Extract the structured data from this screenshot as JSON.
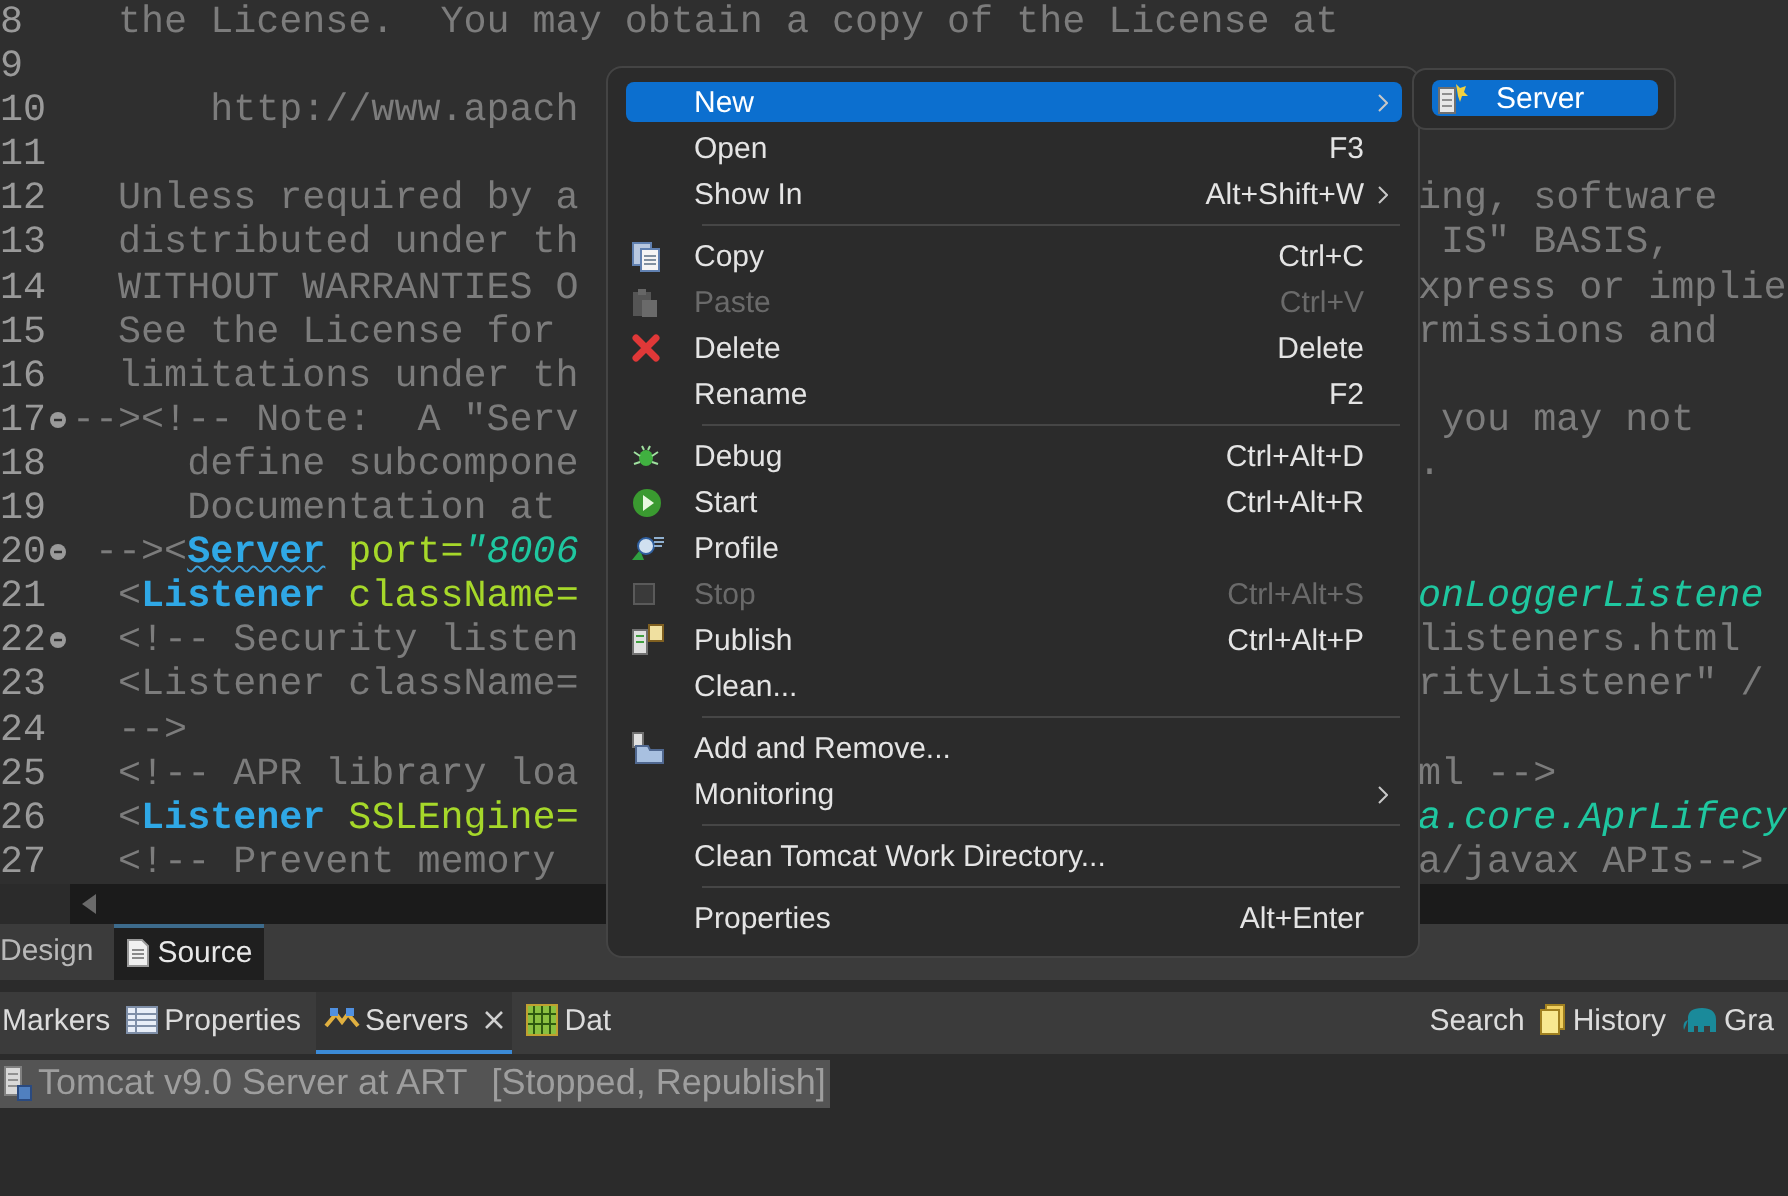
{
  "editor": {
    "lines": [
      {
        "number": "8",
        "left": [
          {
            "kind": "plain",
            "text": "  the License.  You may obtain a copy of the License at"
          }
        ]
      },
      {
        "number": "9"
      },
      {
        "number": "10",
        "left": [
          {
            "kind": "plain",
            "text": "      http://www.apach"
          }
        ]
      },
      {
        "number": "11"
      },
      {
        "number": "12",
        "left": [
          {
            "kind": "plain",
            "text": "  Unless required by a"
          }
        ],
        "right": [
          {
            "kind": "plain",
            "text": "ing, software"
          }
        ]
      },
      {
        "number": "13",
        "left": [
          {
            "kind": "plain",
            "text": "  distributed under th"
          }
        ],
        "right": [
          {
            "kind": "plain",
            "text": " IS\" BASIS,"
          }
        ]
      },
      {
        "number": "14",
        "left": [
          {
            "kind": "plain",
            "text": "  WITHOUT WARRANTIES O"
          }
        ],
        "right": [
          {
            "kind": "plain",
            "text": "xpress or implie"
          }
        ]
      },
      {
        "number": "15",
        "left": [
          {
            "kind": "plain",
            "text": "  See the License for"
          }
        ],
        "right": [
          {
            "kind": "plain",
            "text": "rmissions and"
          }
        ]
      },
      {
        "number": "16",
        "left": [
          {
            "kind": "plain",
            "text": "  limitations under th"
          }
        ]
      },
      {
        "number": "17",
        "foldable": true,
        "left": [
          {
            "kind": "plain",
            "text": "--><!-- Note:  A \"Serv"
          }
        ],
        "right": [
          {
            "kind": "plain",
            "text": " you may not"
          }
        ]
      },
      {
        "number": "18",
        "left": [
          {
            "kind": "plain",
            "text": "     define subcompone"
          }
        ],
        "right": [
          {
            "kind": "plain",
            "text": "."
          }
        ]
      },
      {
        "number": "19",
        "left": [
          {
            "kind": "plain",
            "text": "     Documentation at"
          }
        ]
      },
      {
        "number": "20",
        "foldable": true,
        "left": [
          {
            "kind": "plain",
            "text": " --><"
          },
          {
            "kind": "tag",
            "text": "Server",
            "warning": true
          },
          {
            "kind": "attr",
            "text": " port="
          },
          {
            "kind": "value",
            "text": "\"8006"
          }
        ]
      },
      {
        "number": "21",
        "left": [
          {
            "kind": "plain",
            "text": "  <"
          },
          {
            "kind": "tag",
            "text": "Listener"
          },
          {
            "kind": "attr",
            "text": " className="
          }
        ],
        "right": [
          {
            "kind": "value",
            "text": "onLoggerListene"
          }
        ]
      },
      {
        "number": "22",
        "foldable": true,
        "left": [
          {
            "kind": "plain",
            "text": "  <!-- Security listen"
          }
        ],
        "right": [
          {
            "kind": "plain",
            "text": "listeners.html"
          }
        ]
      },
      {
        "number": "23",
        "left": [
          {
            "kind": "plain",
            "text": "  <Listener className="
          }
        ],
        "right": [
          {
            "kind": "plain",
            "text": "rityListener\" /"
          }
        ]
      },
      {
        "number": "24",
        "left": [
          {
            "kind": "plain",
            "text": "  -->"
          }
        ]
      },
      {
        "number": "25",
        "left": [
          {
            "kind": "plain",
            "text": "  <!-- APR library loa"
          }
        ],
        "right": [
          {
            "kind": "plain",
            "text": "ml -->"
          }
        ]
      },
      {
        "number": "26",
        "left": [
          {
            "kind": "plain",
            "text": "  <"
          },
          {
            "kind": "tag",
            "text": "Listener"
          },
          {
            "kind": "attr",
            "text": " SSLEngine="
          }
        ],
        "right": [
          {
            "kind": "value",
            "text": "a.core.AprLifecy"
          }
        ]
      },
      {
        "number": "27",
        "left": [
          {
            "kind": "plain",
            "text": "  <!-- Prevent memory"
          }
        ],
        "right": [
          {
            "kind": "plain",
            "text": "a/javax APIs-->"
          }
        ]
      }
    ]
  },
  "editor_tabs": [
    {
      "label": "Design",
      "selected": false
    },
    {
      "label": "Source",
      "selected": true
    }
  ],
  "view_tabs": [
    {
      "label": "Markers",
      "selected": false
    },
    {
      "label": "Properties",
      "selected": false
    },
    {
      "label": "Servers",
      "selected": true,
      "closable": true
    },
    {
      "label": "Dat",
      "selected": false
    }
  ],
  "view_tabs_right": [
    {
      "label": "Search",
      "selected": false
    },
    {
      "label": "History",
      "selected": false
    },
    {
      "label": "Gra",
      "selected": false
    }
  ],
  "servers": [
    {
      "label": "Tomcat v9.0 Server at ART",
      "status": "[Stopped, Republish]",
      "selected": true
    }
  ],
  "context_menu": {
    "items": [
      {
        "kind": "item",
        "label": "New",
        "selected": true,
        "submenu": true
      },
      {
        "kind": "item",
        "label": "Open",
        "shortcut": "F3",
        "selected": false
      },
      {
        "kind": "item",
        "label": "Show In",
        "shortcut": "Alt+Shift+W",
        "selected": false,
        "submenu": true
      },
      {
        "kind": "separator"
      },
      {
        "kind": "item",
        "label": "Copy",
        "shortcut": "Ctrl+C",
        "selected": false
      },
      {
        "kind": "item",
        "label": "Paste",
        "shortcut": "Ctrl+V",
        "selected": false,
        "disabled": true
      },
      {
        "kind": "item",
        "label": "Delete",
        "shortcut": "Delete",
        "selected": false
      },
      {
        "kind": "item",
        "label": "Rename",
        "shortcut": "F2",
        "selected": false
      },
      {
        "kind": "separator"
      },
      {
        "kind": "item",
        "label": "Debug",
        "shortcut": "Ctrl+Alt+D",
        "selected": false
      },
      {
        "kind": "item",
        "label": "Start",
        "shortcut": "Ctrl+Alt+R",
        "selected": false
      },
      {
        "kind": "item",
        "label": "Profile",
        "selected": false
      },
      {
        "kind": "item",
        "label": "Stop",
        "shortcut": "Ctrl+Alt+S",
        "selected": false,
        "disabled": true
      },
      {
        "kind": "item",
        "label": "Publish",
        "shortcut": "Ctrl+Alt+P",
        "selected": false
      },
      {
        "kind": "item",
        "label": "Clean...",
        "selected": false
      },
      {
        "kind": "separator"
      },
      {
        "kind": "item",
        "label": "Add and Remove...",
        "selected": false
      },
      {
        "kind": "item",
        "label": "Monitoring",
        "selected": false,
        "submenu": true
      },
      {
        "kind": "separator"
      },
      {
        "kind": "item",
        "label": "Clean Tomcat Work Directory...",
        "selected": false
      },
      {
        "kind": "separator"
      },
      {
        "kind": "item",
        "label": "Properties",
        "shortcut": "Alt+Enter",
        "selected": false
      }
    ]
  },
  "submenu": {
    "items": [
      {
        "label": "Server",
        "selected": true
      }
    ]
  }
}
